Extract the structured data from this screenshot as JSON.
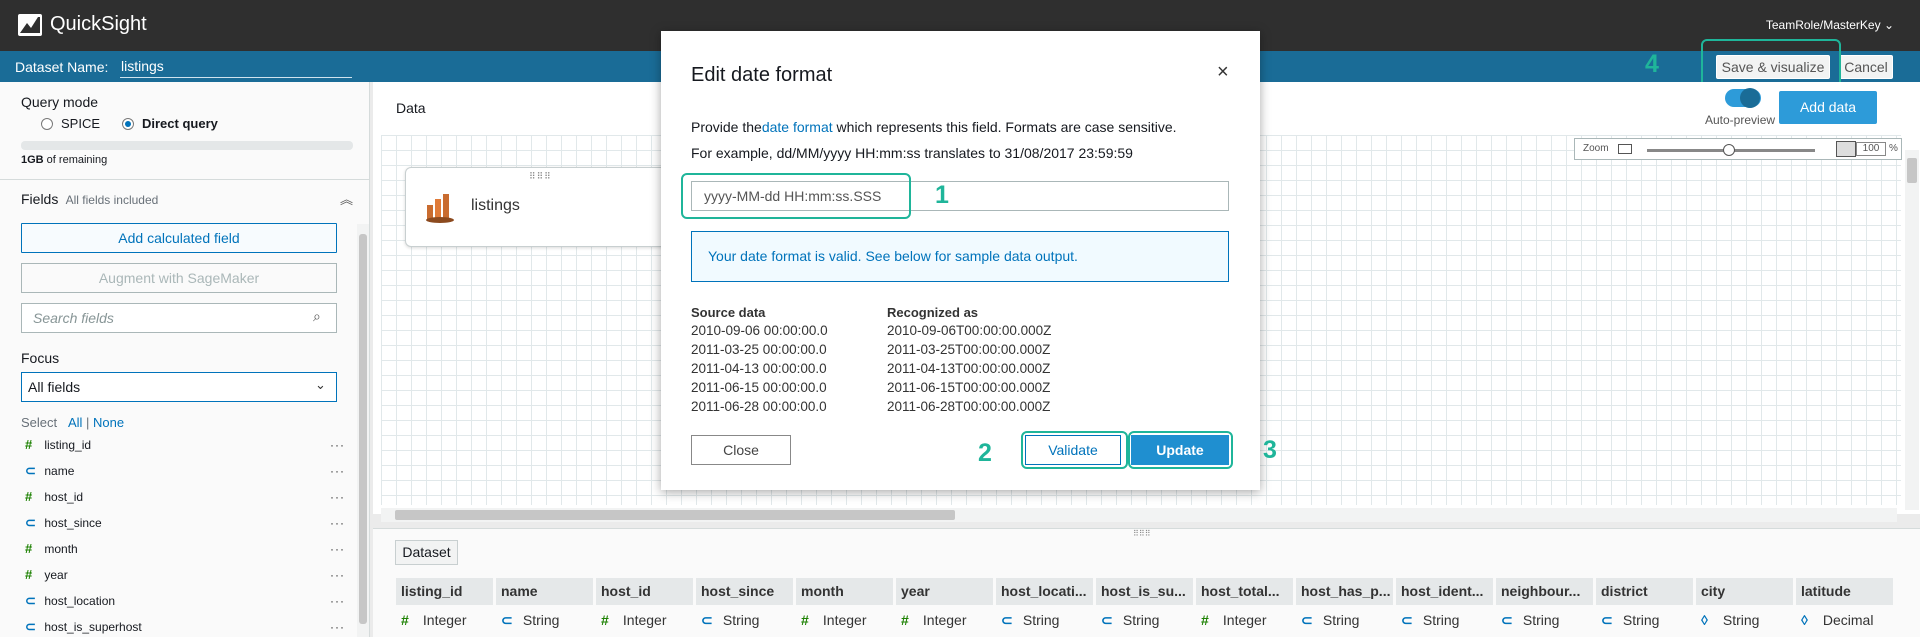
{
  "app": {
    "name": "QuickSight",
    "account": "TeamRole/MasterKey"
  },
  "dataset_bar": {
    "label": "Dataset Name:",
    "value": "listings"
  },
  "top_buttons": {
    "save": "Save & visualize",
    "cancel": "Cancel"
  },
  "left_panel": {
    "query_mode_title": "Query mode",
    "spice": "SPICE",
    "direct": "Direct query",
    "capacity_bold": "1GB",
    "capacity_rest": " of remaining",
    "fields_title": "Fields",
    "fields_sub": "All fields included",
    "add_calc": "Add calculated field",
    "augment": "Augment with SageMaker",
    "search_placeholder": "Search fields",
    "focus_title": "Focus",
    "focus_value": "All fields",
    "select_label": "Select",
    "select_all": "All",
    "select_none": "None",
    "fields": [
      {
        "name": "listing_id",
        "type": "number"
      },
      {
        "name": "name",
        "type": "string"
      },
      {
        "name": "host_id",
        "type": "number"
      },
      {
        "name": "host_since",
        "type": "string"
      },
      {
        "name": "month",
        "type": "number"
      },
      {
        "name": "year",
        "type": "number"
      },
      {
        "name": "host_location",
        "type": "string"
      },
      {
        "name": "host_is_superhost",
        "type": "string"
      }
    ]
  },
  "canvas": {
    "title": "Data",
    "node_label": "listings",
    "add_data": "Add data",
    "auto_preview": "Auto-preview",
    "zoom_label": "Zoom",
    "zoom_value": "100",
    "zoom_unit": "%"
  },
  "bottom": {
    "tab": "Dataset",
    "columns": [
      {
        "name": "listing_id",
        "type": "Integer",
        "icon": "#"
      },
      {
        "name": "name",
        "type": "String",
        "icon": "s"
      },
      {
        "name": "host_id",
        "type": "Integer",
        "icon": "#"
      },
      {
        "name": "host_since",
        "type": "String",
        "icon": "s"
      },
      {
        "name": "month",
        "type": "Integer",
        "icon": "#"
      },
      {
        "name": "year",
        "type": "Integer",
        "icon": "#"
      },
      {
        "name": "host_locati...",
        "type": "String",
        "icon": "s"
      },
      {
        "name": "host_is_su...",
        "type": "String",
        "icon": "s"
      },
      {
        "name": "host_total...",
        "type": "Integer",
        "icon": "#"
      },
      {
        "name": "host_has_p...",
        "type": "String",
        "icon": "s"
      },
      {
        "name": "host_ident...",
        "type": "String",
        "icon": "s"
      },
      {
        "name": "neighbour...",
        "type": "String",
        "icon": "s"
      },
      {
        "name": "district",
        "type": "String",
        "icon": "s"
      },
      {
        "name": "city",
        "type": "String",
        "icon": "geo"
      },
      {
        "name": "latitude",
        "type": "Decimal",
        "icon": "geo"
      }
    ]
  },
  "modal": {
    "title": "Edit date format",
    "desc_pre": "Provide the",
    "desc_link": "date format",
    "desc_post": " which represents this field. Formats are case sensitive.",
    "example": "For example, dd/MM/yyyy HH:mm:ss translates to 31/08/2017 23:59:59",
    "format_value": "yyyy-MM-dd HH:mm:ss.SSS",
    "info": "Your date format is valid. See below for sample data output.",
    "col_source": "Source data",
    "col_recognized": "Recognized as",
    "rows": [
      {
        "source": "2010-09-06 00:00:00.0",
        "recognized": "2010-09-06T00:00:00.000Z"
      },
      {
        "source": "2011-03-25 00:00:00.0",
        "recognized": "2011-03-25T00:00:00.000Z"
      },
      {
        "source": "2011-04-13 00:00:00.0",
        "recognized": "2011-04-13T00:00:00.000Z"
      },
      {
        "source": "2011-06-15 00:00:00.0",
        "recognized": "2011-06-15T00:00:00.000Z"
      },
      {
        "source": "2011-06-28 00:00:00.0",
        "recognized": "2011-06-28T00:00:00.000Z"
      }
    ],
    "close": "Close",
    "validate": "Validate",
    "update": "Update"
  },
  "annotations": {
    "n1": "1",
    "n2": "2",
    "n3": "3",
    "n4": "4"
  },
  "colors": {
    "topbar": "#2f2f2f",
    "dataset_bar": "#1a6c97",
    "accent": "#0073bb",
    "annotation": "#1fb59a"
  }
}
